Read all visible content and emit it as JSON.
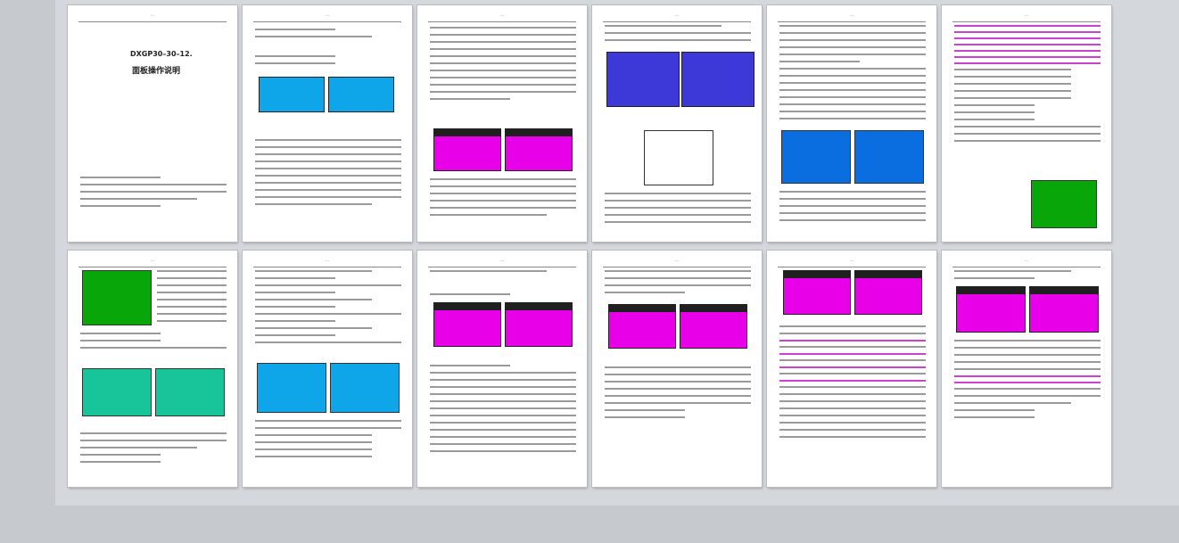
{
  "document": {
    "page1": {
      "title": "DXGP30–30–12.",
      "subtitle": "面板操作说明"
    },
    "pages": [
      {
        "id": "p1"
      },
      {
        "id": "p2"
      },
      {
        "id": "p3"
      },
      {
        "id": "p4"
      },
      {
        "id": "p5"
      },
      {
        "id": "p6"
      },
      {
        "id": "p7"
      },
      {
        "id": "p8"
      },
      {
        "id": "p9"
      },
      {
        "id": "p10"
      },
      {
        "id": "p11"
      },
      {
        "id": "p12"
      }
    ]
  },
  "colors": {
    "magenta": "#e800e8",
    "green": "#09a609",
    "blue": "#0a6de0",
    "cyan": "#1fd6f0"
  }
}
